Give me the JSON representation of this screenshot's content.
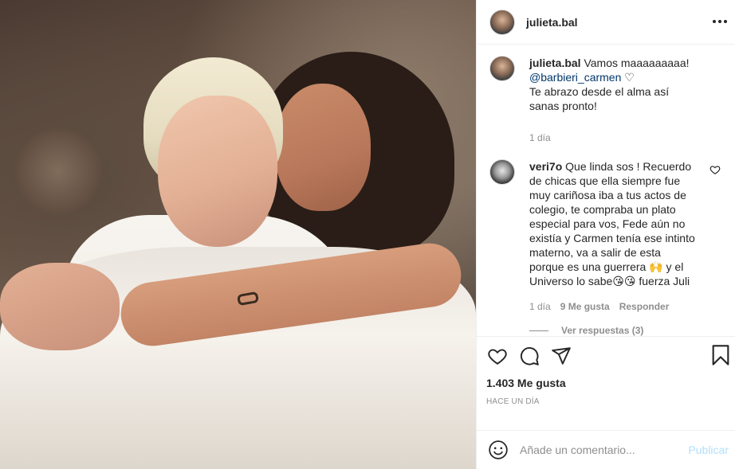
{
  "post": {
    "username": "julieta.bal",
    "caption": {
      "username": "julieta.bal",
      "text_before": "Vamos maaaaaaaaa!",
      "mention": "@barbieri_carmen",
      "mention_suffix": " ♡",
      "text_after": "Te abrazo desde el alma así sanas pronto!",
      "time": "1 día"
    },
    "comments": [
      {
        "username": "veri7o",
        "text": "Que linda sos ! Recuerdo de chicas que ella siempre fue muy cariñosa iba a tus actos de colegio, te compraba un plato especial para vos, Fede aún no existía y Carmen tenía ese intinto materno, va a salir de esta porque es una guerrera 🙌 y el Universo lo sabe😘😘 fuerza Juli",
        "time": "1 día",
        "likes": "9 Me gusta",
        "reply_label": "Responder",
        "view_replies": "Ver respuestas (3)"
      }
    ],
    "likes_count": "1.403 Me gusta",
    "time_ago": "HACE UN DÍA",
    "add_comment_placeholder": "Añade un comentario...",
    "publish_label": "Publicar"
  },
  "icons": {
    "more": "more-options-icon",
    "like": "heart-icon",
    "comment": "comment-icon",
    "share": "share-icon",
    "save": "bookmark-icon",
    "emoji": "emoji-icon"
  },
  "colors": {
    "mention": "#00376b",
    "publish_disabled": "#b2dffc",
    "muted": "#8e8e8e"
  }
}
